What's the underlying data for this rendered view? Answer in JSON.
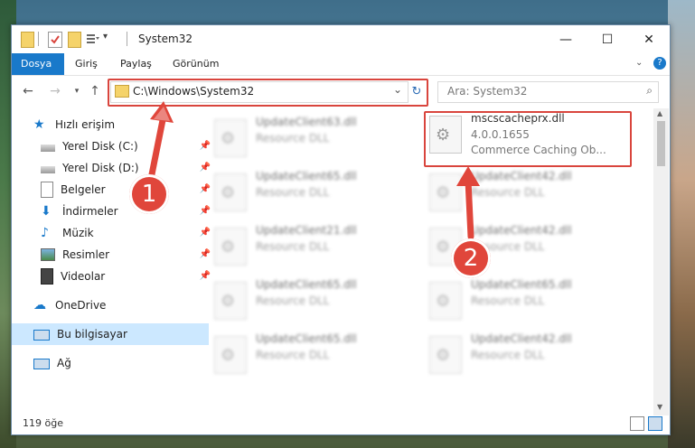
{
  "window": {
    "title": "System32"
  },
  "ribbon": {
    "tabs": [
      "Dosya",
      "Giriş",
      "Paylaş",
      "Görünüm"
    ]
  },
  "window_controls": {
    "minimize": "—",
    "maximize": "☐",
    "close": "✕"
  },
  "address_bar": {
    "path": "C:\\Windows\\System32",
    "dropdown": "⌄",
    "refresh": "↻"
  },
  "search": {
    "placeholder": "Ara: System32"
  },
  "sidebar": {
    "items": [
      {
        "label": "Hızlı erişim"
      },
      {
        "label": "Yerel Disk (C:)"
      },
      {
        "label": "Yerel Disk (D:)"
      },
      {
        "label": "Belgeler"
      },
      {
        "label": "İndirmeler"
      },
      {
        "label": "Müzik"
      },
      {
        "label": "Resimler"
      },
      {
        "label": "Videolar"
      },
      {
        "label": "OneDrive"
      },
      {
        "label": "Bu bilgisayar"
      },
      {
        "label": "Ağ"
      }
    ]
  },
  "files": {
    "highlighted": {
      "name": "mscscacheprx.dll",
      "version": "4.0.0.1655",
      "description": "Commerce Caching Ob..."
    },
    "blurred": [
      {
        "name": "UpdateClient63.dll",
        "desc": "Resource DLL"
      },
      {
        "name": "UpdateClient65.dll",
        "desc": "Resource DLL"
      },
      {
        "name": "UpdateClient42.dll",
        "desc": "Resource DLL"
      },
      {
        "name": "UpdateClient21.dll",
        "desc": "Resource DLL"
      },
      {
        "name": "UpdateClient42.dll",
        "desc": "Resource DLL"
      },
      {
        "name": "UpdateClient65.dll",
        "desc": "Resource DLL"
      },
      {
        "name": "UpdateClient65.dll",
        "desc": "Resource DLL"
      },
      {
        "name": "UpdateClient65.dll",
        "desc": "Resource DLL"
      },
      {
        "name": "UpdateClient42.dll",
        "desc": "Resource DLL"
      }
    ]
  },
  "status": {
    "count": "119 öğe"
  },
  "callouts": {
    "one": "1",
    "two": "2"
  },
  "colors": {
    "accent": "#1979ca",
    "highlight": "#d9453d",
    "callout": "#e0463b"
  }
}
